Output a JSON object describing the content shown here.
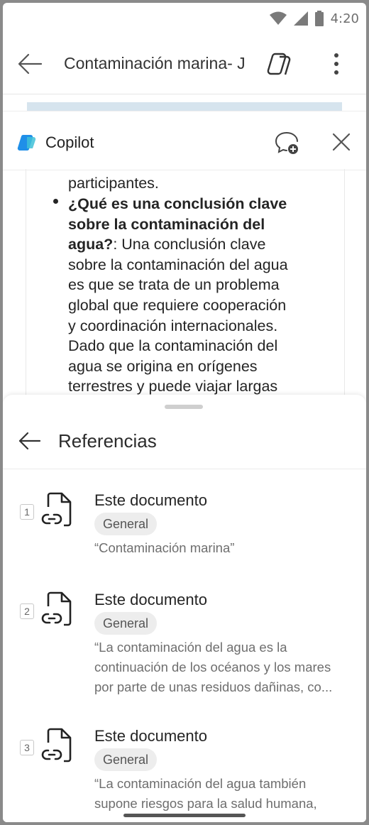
{
  "status": {
    "time": "4:20"
  },
  "appbar": {
    "doc_title": "Contaminación marina- J"
  },
  "copilot": {
    "title": "Copilot",
    "partial_line": "participantes.",
    "bullet_bold": [
      "¿Qué es una conclusión clave",
      "sobre la contaminación del",
      "agua?"
    ],
    "bullet_rest_first": ": Una conclusión clave",
    "bullet_lines": [
      "sobre la contaminación del agua",
      "es que se trata de un problema",
      "global que requiere cooperación",
      "y coordinación internacionales.",
      "Dado que la contaminación del",
      "agua se origina en orígenes",
      "terrestres y puede viajar largas"
    ]
  },
  "references": {
    "title": "Referencias",
    "items": [
      {
        "num": "1",
        "title": "Este documento",
        "tag": "General",
        "quote": [
          "“Contaminación marina”"
        ]
      },
      {
        "num": "2",
        "title": "Este documento",
        "tag": "General",
        "quote": [
          "“La contaminación del agua es la",
          "continuación de los océanos y los mares",
          "por parte de unas residuos dañinas, co..."
        ]
      },
      {
        "num": "3",
        "title": "Este documento",
        "tag": "General",
        "quote": [
          "“La contaminación del agua también",
          "supone riesgos para la salud humana,"
        ]
      }
    ]
  },
  "colors": {
    "copilot_blue": "#1f8fe8",
    "copilot_teal": "#3fc1d8"
  }
}
